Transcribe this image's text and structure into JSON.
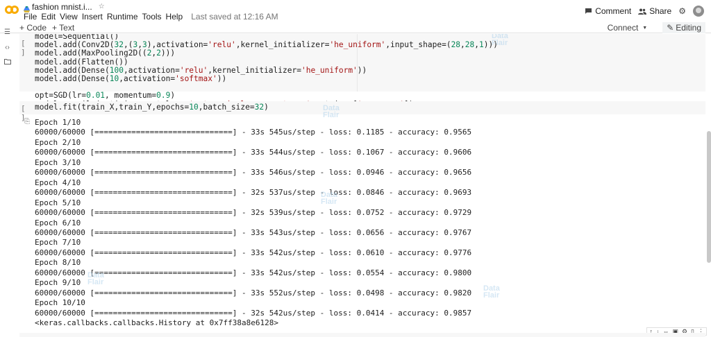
{
  "header": {
    "doc_title": "fashion mnist.i...",
    "menu": [
      "File",
      "Edit",
      "View",
      "Insert",
      "Runtime",
      "Tools",
      "Help"
    ],
    "last_saved": "Last saved at 12:16 AM",
    "comment_label": "Comment",
    "share_label": "Share"
  },
  "toolbar": {
    "code_label": "+ Code",
    "text_label": "+ Text",
    "connect_label": "Connect",
    "editing_label": "Editing"
  },
  "cell1": {
    "gutter": "[ ]",
    "lines": [
      "model=Sequential()",
      "model.add(Conv2D(32,(3,3),activation='relu',kernel_initializer='he_uniform',input_shape=(28,28,1)))",
      "model.add(MaxPooling2D((2,2)))",
      "model.add(Flatten())",
      "model.add(Dense(100,activation='relu',kernel_initializer='he_uniform'))",
      "model.add(Dense(10,activation='softmax'))",
      "",
      "opt=SGD(lr=0.01, momentum=0.9)",
      "model.compile(optimizer=opt,loss='categorical_crossentropy',metrics=['accuracy'])"
    ]
  },
  "cell2": {
    "gutter": "[ ]",
    "code": "model.fit(train_X,train_Y,epochs=10,batch_size=32)"
  },
  "output": {
    "lines": [
      "Epoch 1/10",
      "60000/60000 [==============================] - 33s 545us/step - loss: 0.1185 - accuracy: 0.9565",
      "Epoch 2/10",
      "60000/60000 [==============================] - 33s 544us/step - loss: 0.1067 - accuracy: 0.9606",
      "Epoch 3/10",
      "60000/60000 [==============================] - 33s 546us/step - loss: 0.0946 - accuracy: 0.9656",
      "Epoch 4/10",
      "60000/60000 [==============================] - 32s 537us/step - loss: 0.0846 - accuracy: 0.9693",
      "Epoch 5/10",
      "60000/60000 [==============================] - 32s 539us/step - loss: 0.0752 - accuracy: 0.9729",
      "Epoch 6/10",
      "60000/60000 [==============================] - 33s 543us/step - loss: 0.0656 - accuracy: 0.9767",
      "Epoch 7/10",
      "60000/60000 [==============================] - 33s 542us/step - loss: 0.0610 - accuracy: 0.9776",
      "Epoch 8/10",
      "60000/60000 [==============================] - 33s 542us/step - loss: 0.0554 - accuracy: 0.9800",
      "Epoch 9/10",
      "60000/60000 [==============================] - 33s 552us/step - loss: 0.0498 - accuracy: 0.9820",
      "Epoch 10/10",
      "60000/60000 [==============================] - 32s 542us/step - loss: 0.0414 - accuracy: 0.9857",
      "<keras.callbacks.callbacks.History at 0x7ff38a8e6128>"
    ]
  },
  "cell_toolbar": [
    "↑",
    "↓",
    "⇔",
    "▣",
    "⚙",
    "▯",
    "⋮"
  ],
  "icons": {
    "logo": "colab-logo-icon",
    "drive": "drive-icon",
    "star": "star-icon",
    "comment": "comment-icon",
    "share": "share-icon",
    "settings": "gear-icon",
    "toc": "table-of-contents-icon",
    "code_snippets": "code-snippets-icon",
    "files": "folder-icon",
    "output": "output-icon"
  },
  "colors": {
    "logo_orange": "#F9AB00",
    "string": "#A31515",
    "number": "#098658"
  },
  "watermark": [
    "Data",
    "Flair"
  ]
}
